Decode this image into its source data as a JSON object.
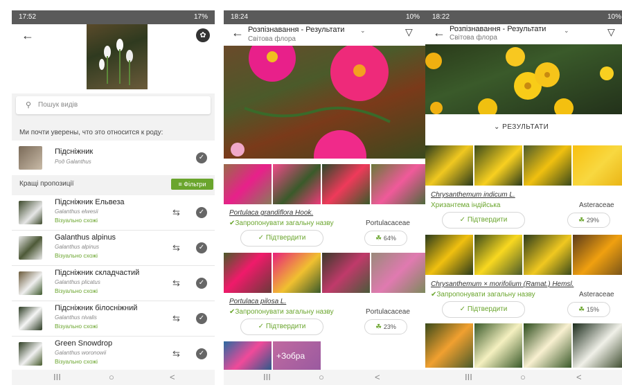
{
  "screen1": {
    "status_time": "17:52",
    "status_right": "17%",
    "search_placeholder": "Пошук видів",
    "almost_sure": "Ми почти уверены, что это относится к роду:",
    "genus": {
      "name": "Підсніжник",
      "latin": "Род Galanthus"
    },
    "best_label": "Кращі пропозиції",
    "filters_button": "Фільтри",
    "suggestions": [
      {
        "name": "Підсніжник Ельвеза",
        "latin": "Galanthus elwesii",
        "note": "Візуально схожі"
      },
      {
        "name": "Galanthus alpinus",
        "latin": "Galanthus alpinus",
        "note": "Візуально схожі"
      },
      {
        "name": "Підсніжник складчастий",
        "latin": "Galanthus plicatus",
        "note": "Візуально схожі"
      },
      {
        "name": "Підсніжник білосніжний",
        "latin": "Galanthus nivalis",
        "note": "Візуально схожі"
      },
      {
        "name": "Green Snowdrop",
        "latin": "Galanthus woronowii",
        "note": "Візуально схожі"
      }
    ],
    "nav": [
      "III",
      "○",
      "<"
    ]
  },
  "screen2": {
    "status_time": "18:24",
    "status_right": "10%",
    "title": "Розпізнавання - Результати",
    "subtitle": "Світова флора",
    "results": [
      {
        "latin": "Portulaca grandiflora Hook.",
        "common": "✔Запропонувати загальну назву",
        "family": "Portulacaceae",
        "confirm": "✓ Підтвердити",
        "score": "64%"
      },
      {
        "latin": "Portulaca pilosa L.",
        "common": "✔Запропонувати загальну назву",
        "family": "Portulacaceae",
        "confirm": "✓ Підтвердити",
        "score": "23%"
      }
    ],
    "more_label": "+Зобра",
    "nav": [
      "III",
      "○",
      "<"
    ]
  },
  "screen3": {
    "status_time": "18:22",
    "status_right": "10%",
    "title": "Розпізнавання - Результати",
    "subtitle": "Світова флора",
    "results_header": "РЕЗУЛЬТАТИ",
    "results": [
      {
        "latin": "Chrysanthemum indicum L.",
        "common": "Хризантема індійська",
        "family": "Asteraceae",
        "confirm": "✓ Підтвердити",
        "score": "29%"
      },
      {
        "latin": "Chrysanthemum × morifolium (Ramat.) Hemsl.",
        "common": "✔Запропонувати загальну назву",
        "family": "Asteraceae",
        "confirm": "✓ Підтвердити",
        "score": "15%"
      }
    ],
    "nav": [
      "III",
      "○",
      "<"
    ]
  },
  "colors": {
    "accent_green": "#6aa52d",
    "status_bar": "#5a5a5a"
  },
  "icons": [
    "back-arrow-icon",
    "search-icon",
    "swap-icon",
    "check-circle-icon",
    "filter-icon",
    "leaf-icon",
    "chevron-down-icon",
    "flower-share-icon"
  ]
}
